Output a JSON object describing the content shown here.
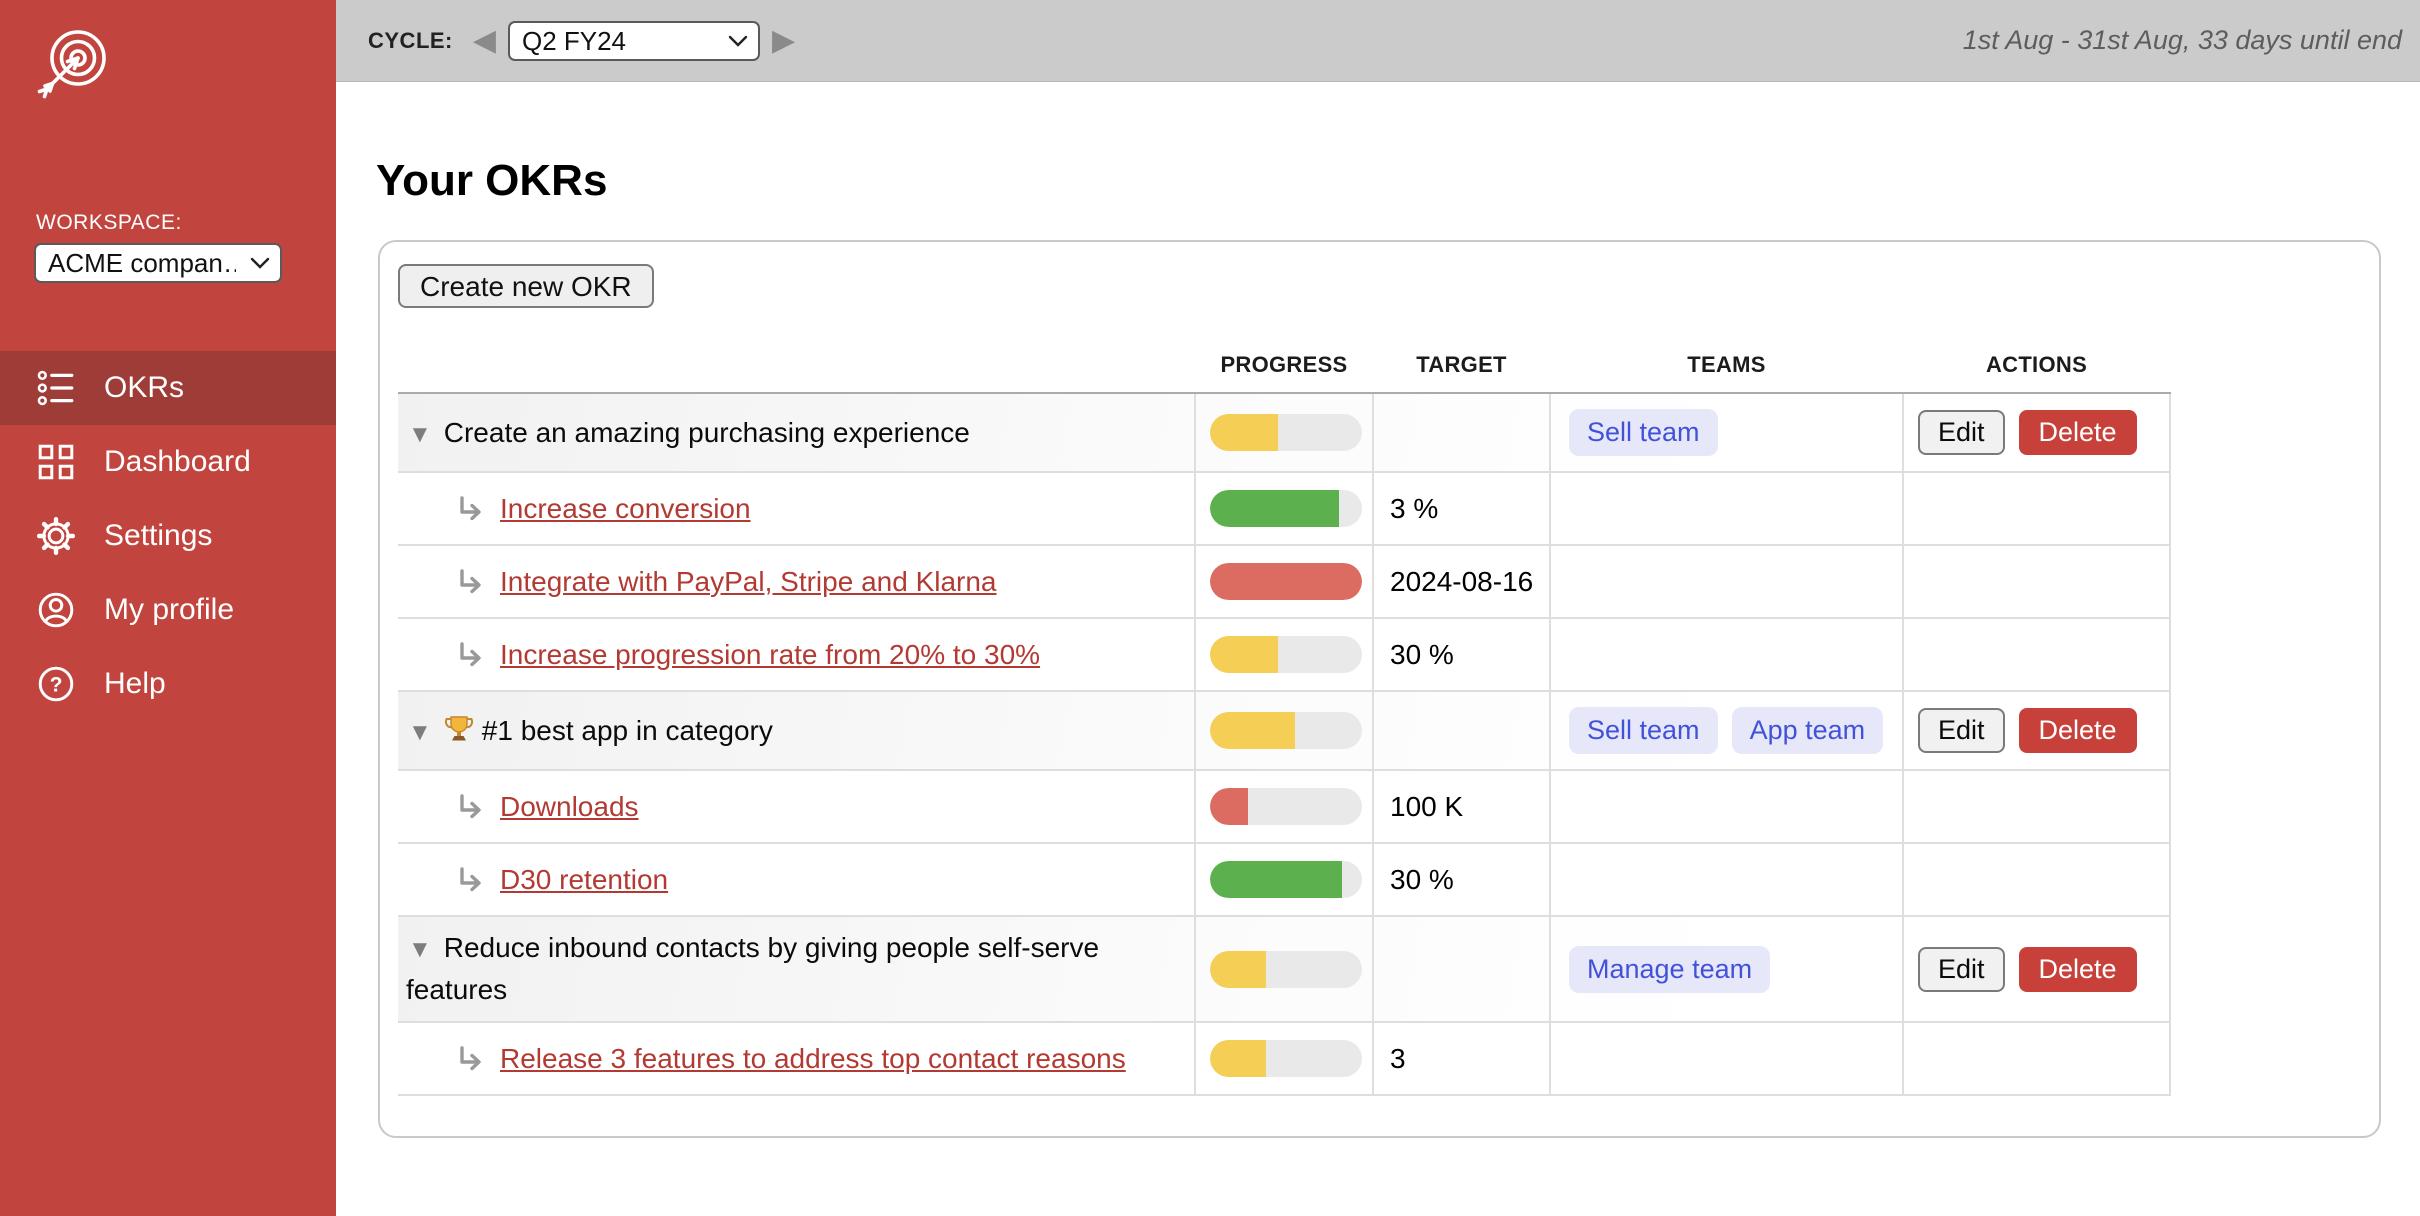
{
  "topbar": {
    "cycle_label": "CYCLE:",
    "cycle_value": "Q2 FY24",
    "date_range": "1st Aug - 31st Aug, 33 days until end"
  },
  "sidebar": {
    "workspace_label": "WORKSPACE:",
    "workspace_value": "ACME compan…",
    "items": [
      {
        "label": "OKRs",
        "icon": "okr-list-icon",
        "active": true
      },
      {
        "label": "Dashboard",
        "icon": "dashboard-icon",
        "active": false
      },
      {
        "label": "Settings",
        "icon": "settings-gear-icon",
        "active": false
      },
      {
        "label": "My profile",
        "icon": "profile-icon",
        "active": false
      },
      {
        "label": "Help",
        "icon": "help-icon",
        "active": false
      }
    ]
  },
  "main": {
    "title": "Your OKRs",
    "create_button": "Create new OKR",
    "table": {
      "headers": [
        "PROGRESS",
        "TARGET",
        "TEAMS",
        "ACTIONS"
      ],
      "actions": {
        "edit": "Edit",
        "delete": "Delete"
      },
      "rows": [
        {
          "type": "objective",
          "title": "Create an amazing purchasing experience",
          "trophy": false,
          "progress": 45,
          "progress_color": "yellow",
          "target": "",
          "teams": [
            "Sell team"
          ],
          "has_actions": true
        },
        {
          "type": "kr",
          "title": "Increase conversion",
          "trophy": false,
          "progress": 85,
          "progress_color": "green",
          "target": "3 %",
          "teams": [],
          "has_actions": false
        },
        {
          "type": "kr",
          "title": "Integrate with PayPal, Stripe and Klarna",
          "trophy": false,
          "progress": 100,
          "progress_color": "red",
          "target": "2024-08-16",
          "teams": [],
          "has_actions": false
        },
        {
          "type": "kr",
          "title": "Increase progression rate from 20% to 30%",
          "trophy": false,
          "progress": 45,
          "progress_color": "yellow",
          "target": "30 %",
          "teams": [],
          "has_actions": false
        },
        {
          "type": "objective",
          "title": "#1 best app in category",
          "trophy": true,
          "progress": 56,
          "progress_color": "yellow",
          "target": "",
          "teams": [
            "Sell team",
            "App team"
          ],
          "has_actions": true
        },
        {
          "type": "kr",
          "title": "Downloads",
          "trophy": false,
          "progress": 25,
          "progress_color": "red",
          "target": "100 K",
          "teams": [],
          "has_actions": false
        },
        {
          "type": "kr",
          "title": "D30 retention",
          "trophy": false,
          "progress": 87,
          "progress_color": "green",
          "target": "30 %",
          "teams": [],
          "has_actions": false
        },
        {
          "type": "objective",
          "title": "Reduce inbound contacts by giving people self-serve features",
          "trophy": false,
          "progress": 37,
          "progress_color": "yellow",
          "target": "",
          "teams": [
            "Manage team"
          ],
          "has_actions": true
        },
        {
          "type": "kr",
          "title": "Release 3 features to address top contact reasons",
          "trophy": false,
          "progress": 37,
          "progress_color": "yellow",
          "target": "3",
          "teams": [],
          "has_actions": false
        }
      ]
    }
  },
  "colors": {
    "sidebar_red": "#c1453e",
    "sidebar_active_red": "#9e3d38",
    "link_red": "#b23a33",
    "delete_red": "#c7413a",
    "team_badge_bg": "#e7e7fa",
    "team_badge_text": "#4152d9",
    "progress": {
      "yellow": "#f5ce55",
      "green": "#5cb04e",
      "red": "#dc6b62",
      "track": "#e9e9e9"
    }
  }
}
